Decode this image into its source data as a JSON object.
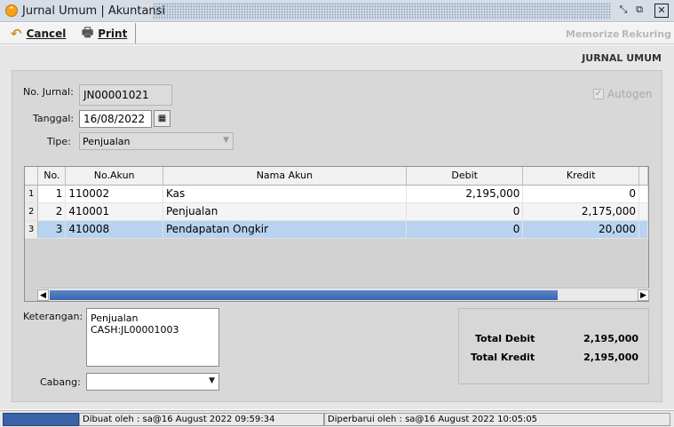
{
  "window": {
    "title": "Jurnal Umum | Akuntansi"
  },
  "toolbar": {
    "cancel_label": "Cancel",
    "print_label": "Print",
    "memorize_label": "Memorize",
    "rekuring_label": "Rekuring"
  },
  "section_title": "JURNAL UMUM",
  "form": {
    "no_jurnal_label": "No. Jurnal:",
    "no_jurnal_value": "JN00001021",
    "tanggal_label": "Tanggal:",
    "tanggal_value": "16/08/2022",
    "tipe_label": "Tipe:",
    "tipe_value": "Penjualan",
    "autogen_label": "Autogen",
    "keterangan_label": "Keterangan:",
    "keterangan_value": "Penjualan CASH:JL00001003",
    "cabang_label": "Cabang:",
    "cabang_value": ""
  },
  "grid": {
    "columns": [
      "No.",
      "No.Akun",
      "Nama Akun",
      "Debit",
      "Kredit"
    ],
    "rows": [
      {
        "row": "1",
        "no": "1",
        "akun": "110002",
        "nama": "Kas",
        "debit": "2,195,000",
        "kredit": "0"
      },
      {
        "row": "2",
        "no": "2",
        "akun": "410001",
        "nama": "Penjualan",
        "debit": "0",
        "kredit": "2,175,000"
      },
      {
        "row": "3",
        "no": "3",
        "akun": "410008",
        "nama": "Pendapatan Ongkir",
        "debit": "0",
        "kredit": "20,000"
      }
    ]
  },
  "totals": {
    "debit_label": "Total Debit",
    "debit_value": "2,195,000",
    "kredit_label": "Total Kredit",
    "kredit_value": "2,195,000"
  },
  "status": {
    "created": "Dibuat oleh : sa@16 August 2022  09:59:34",
    "updated": "Diperbarui oleh : sa@16 August 2022  10:05:05"
  },
  "colors": {
    "selected_row": "#b8d3f0",
    "scroll_thumb": "#3a63a8"
  }
}
